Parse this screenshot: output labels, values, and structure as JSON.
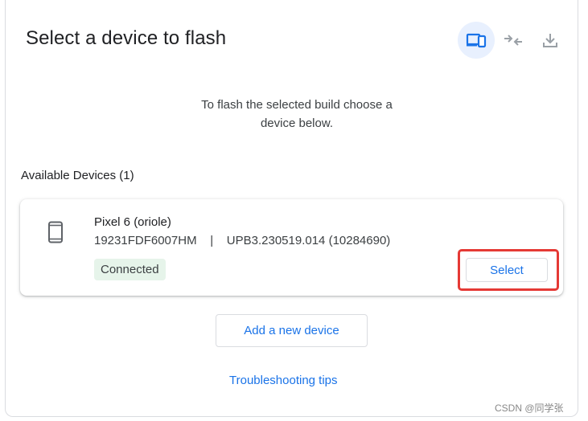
{
  "header": {
    "title": "Select a device to flash",
    "steps": [
      {
        "icon": "devices-icon",
        "active": true
      },
      {
        "icon": "connect-arrows-icon",
        "active": false
      },
      {
        "icon": "download-icon",
        "active": false
      }
    ]
  },
  "intro": {
    "line1": "To flash the selected build choose a",
    "line2": "device below."
  },
  "devices_section": {
    "label": "Available Devices (1)",
    "devices": [
      {
        "icon": "smartphone-icon",
        "name": "Pixel 6 (oriole)",
        "meta": "19231FDF6007HM    |    UPB3.230519.014 (10284690)",
        "status": "Connected",
        "select_label": "Select"
      }
    ]
  },
  "actions": {
    "add_device_label": "Add a new device",
    "troubleshooting_label": "Troubleshooting tips"
  },
  "watermark": "CSDN @同学张",
  "colors": {
    "accent": "#1a73e8",
    "chip_bg": "#e6f4ea",
    "highlight": "#e53935",
    "active_step_bg": "#e8f0fe"
  }
}
